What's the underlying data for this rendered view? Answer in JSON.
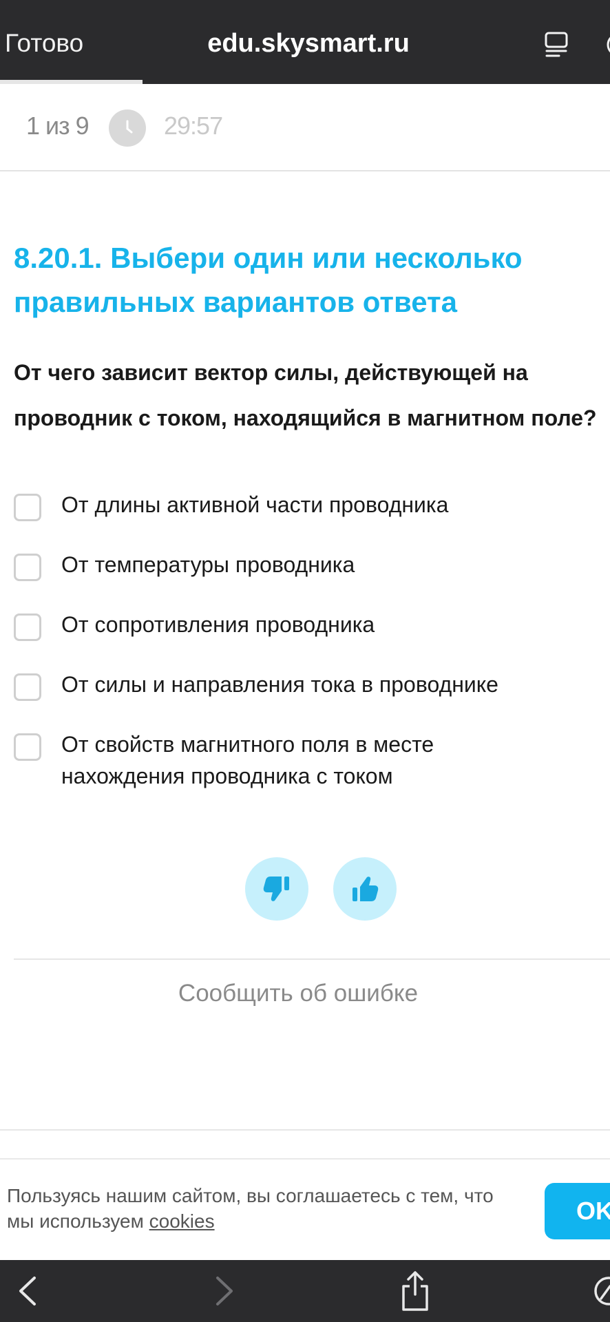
{
  "browser": {
    "done_label": "Готово",
    "url": "edu.skysmart.ru",
    "icons": [
      "reader-icon",
      "compass-icon",
      "back-icon",
      "forward-icon",
      "share-icon"
    ]
  },
  "quiz": {
    "counter": "1 из 9",
    "timer": "29:57",
    "clock_icon": "clock-icon"
  },
  "task": {
    "title": "8.20.1. Выбери один или несколько правильных вариантов ответа",
    "question": "От чего зависит вектор силы, действующей на проводник с током, находящийся в магнитном поле?",
    "options": [
      {
        "label": "От длины активной части проводника",
        "checked": false
      },
      {
        "label": "От температуры проводника",
        "checked": false
      },
      {
        "label": "От сопротивления проводника",
        "checked": false
      },
      {
        "label": "От силы и направления тока в проводнике",
        "checked": false
      },
      {
        "label": "От свойств магнитного поля в месте нахождения проводника с током",
        "checked": false
      }
    ]
  },
  "feedback": {
    "dislike_icon": "thumbs-down-icon",
    "like_icon": "thumbs-up-icon",
    "report_label": "Сообщить об ошибке"
  },
  "cookie_banner": {
    "text": "Пользуясь нашим сайтом, вы соглашаетесь с тем, что мы используем",
    "link": "cookies",
    "ok_label": "OK"
  },
  "colors": {
    "accent": "#17b3ea",
    "ok_button": "#11b4ef",
    "feedback_bg": "#c6f0fc",
    "toolbar": "#2b2b2d"
  }
}
